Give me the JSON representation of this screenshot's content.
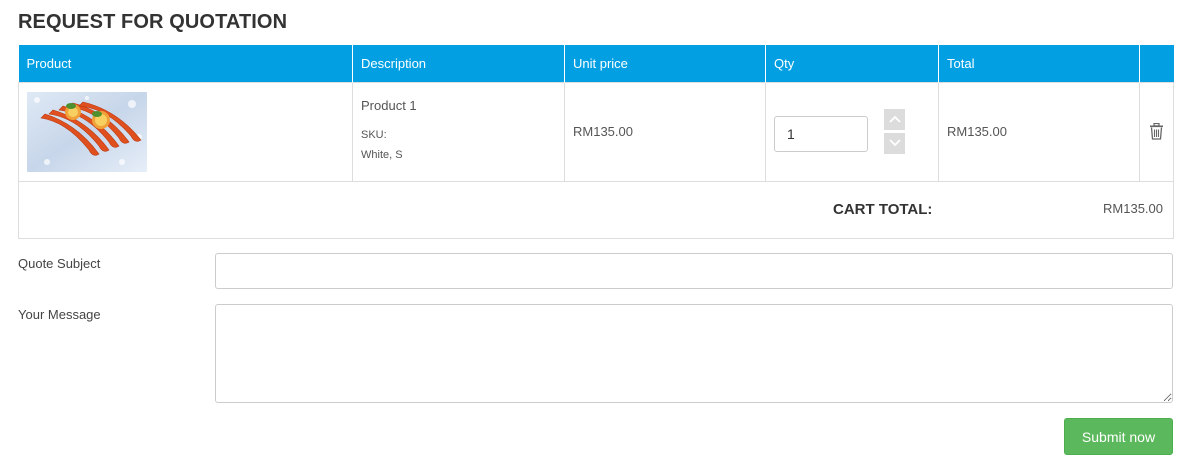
{
  "page": {
    "title": "REQUEST FOR QUOTATION"
  },
  "table": {
    "headers": [
      "Product",
      "Description",
      "Unit price",
      "Qty",
      "Total",
      ""
    ],
    "rows": [
      {
        "image_alt": "shrimp-product-image",
        "name": "Product 1",
        "sku_label": "SKU:",
        "variant": "White, S",
        "unit_price": "RM135.00",
        "qty": "1",
        "total": "RM135.00"
      }
    ],
    "cart_total_label": "CART TOTAL:",
    "cart_total_value": "RM135.00"
  },
  "form": {
    "subject_label": "Quote Subject",
    "subject_value": "",
    "message_label": "Your Message",
    "message_value": "",
    "submit_label": "Submit now"
  },
  "colors": {
    "header_bg": "#02a0e3",
    "submit_bg": "#5cb85c",
    "border": "#dddddd"
  },
  "icons": {
    "qty_up": "chevron-up-icon",
    "qty_down": "chevron-down-icon",
    "remove": "trash-icon"
  }
}
